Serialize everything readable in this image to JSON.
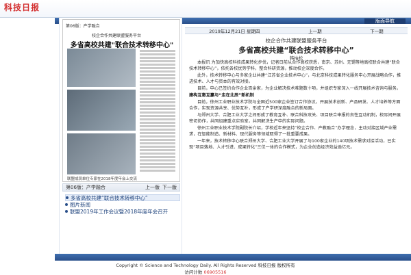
{
  "header": {
    "logo": "科技日报",
    "nav_label": "版面导航"
  },
  "left": {
    "thumb_paper_page": "第06版：产学融合",
    "thumb_subtitle": "校企合作共建联盟服务平台",
    "thumb_title": "多省高校共建\"联合技术转移中心\"",
    "thumb_caption": "联盟成员单位专家在2018年度年会上交流",
    "page_label": "第06版：产学融合",
    "prev": "上一版",
    "next": "下一版",
    "list": [
      {
        "label": "多省高校共建“联合技术转移中心”",
        "active": true
      },
      {
        "label": "图片新闻",
        "active": false
      },
      {
        "label": "联盟2019年工作会议暨2018年度年会召开",
        "active": false
      }
    ]
  },
  "article": {
    "date_line": "2019年12月21日 星期四",
    "prev_page": "上一期",
    "next_page": "下一期",
    "pretitle": "校企合作共建联盟服务平台",
    "headline": "多省高校共建“联合技术转移中心”",
    "byline": "韩柏松",
    "paragraphs": [
      {
        "text": "本报讯 为加快高校科技成果转化步伐，记者日前从合作高校获悉，南京、苏州、无锡等地高校联合共建“联合技术转移中心”，依托各校优势学科，整合科研资源，推动校企深度合作。",
        "sub": false
      },
      {
        "text": "此外，技术转移中心与多家企业共建“江苏省企业技术中心”，与北京科技成果转化服务中心开展战略合作，推进技术、人才与资本的有效对接。",
        "sub": false
      },
      {
        "text": "目前，中心已签约合作企业百余家，为企业解决技术难题数十项，并组织专家深入一线开展技术咨询与服务。",
        "sub": false
      },
      {
        "text": "建构互惠互赢与“走在北辰”新机制",
        "sub": true
      },
      {
        "text": "目前，徐州工业职业技术学院与全国近500家企业签订合作协议，开展技术创新、产品研发、人才培养等方面合作，实现资源共享、优势互补，形成了产学研深度融合的新局面。",
        "sub": false
      },
      {
        "text": "与郑州大学、合肥工业大学之间形成了教育互补、联合科技攻关、项目联合申报的良性互动机制，校际间开展密切协作，共同组建重点实验室，共同解决生产中的实际问题。",
        "sub": false
      },
      {
        "text": "徐州工业职业技术学院副院长介绍，学校近年来坚持“校企合作、产教融合”办学理念，主动对接区域产业需求，在智能制造、新材料、现代服务等领域取得了一批重要成果。",
        "sub": false
      },
      {
        "text": "一年来，技术转移中心联合郑州大学、合肥工业大学开展了与100家企业的140项技术需求对接活动，已实现“项目落地、人才引进、成果转化”三位一体的合作模式，为企业创造经济效益逾亿元。",
        "sub": false
      }
    ]
  },
  "footer": {
    "copyright": "Copyright © Science and Technology Daily. All Rights Reserved 科技日报 版权所有",
    "visitor_label": "访问计数",
    "visitor_count": "06905516"
  }
}
